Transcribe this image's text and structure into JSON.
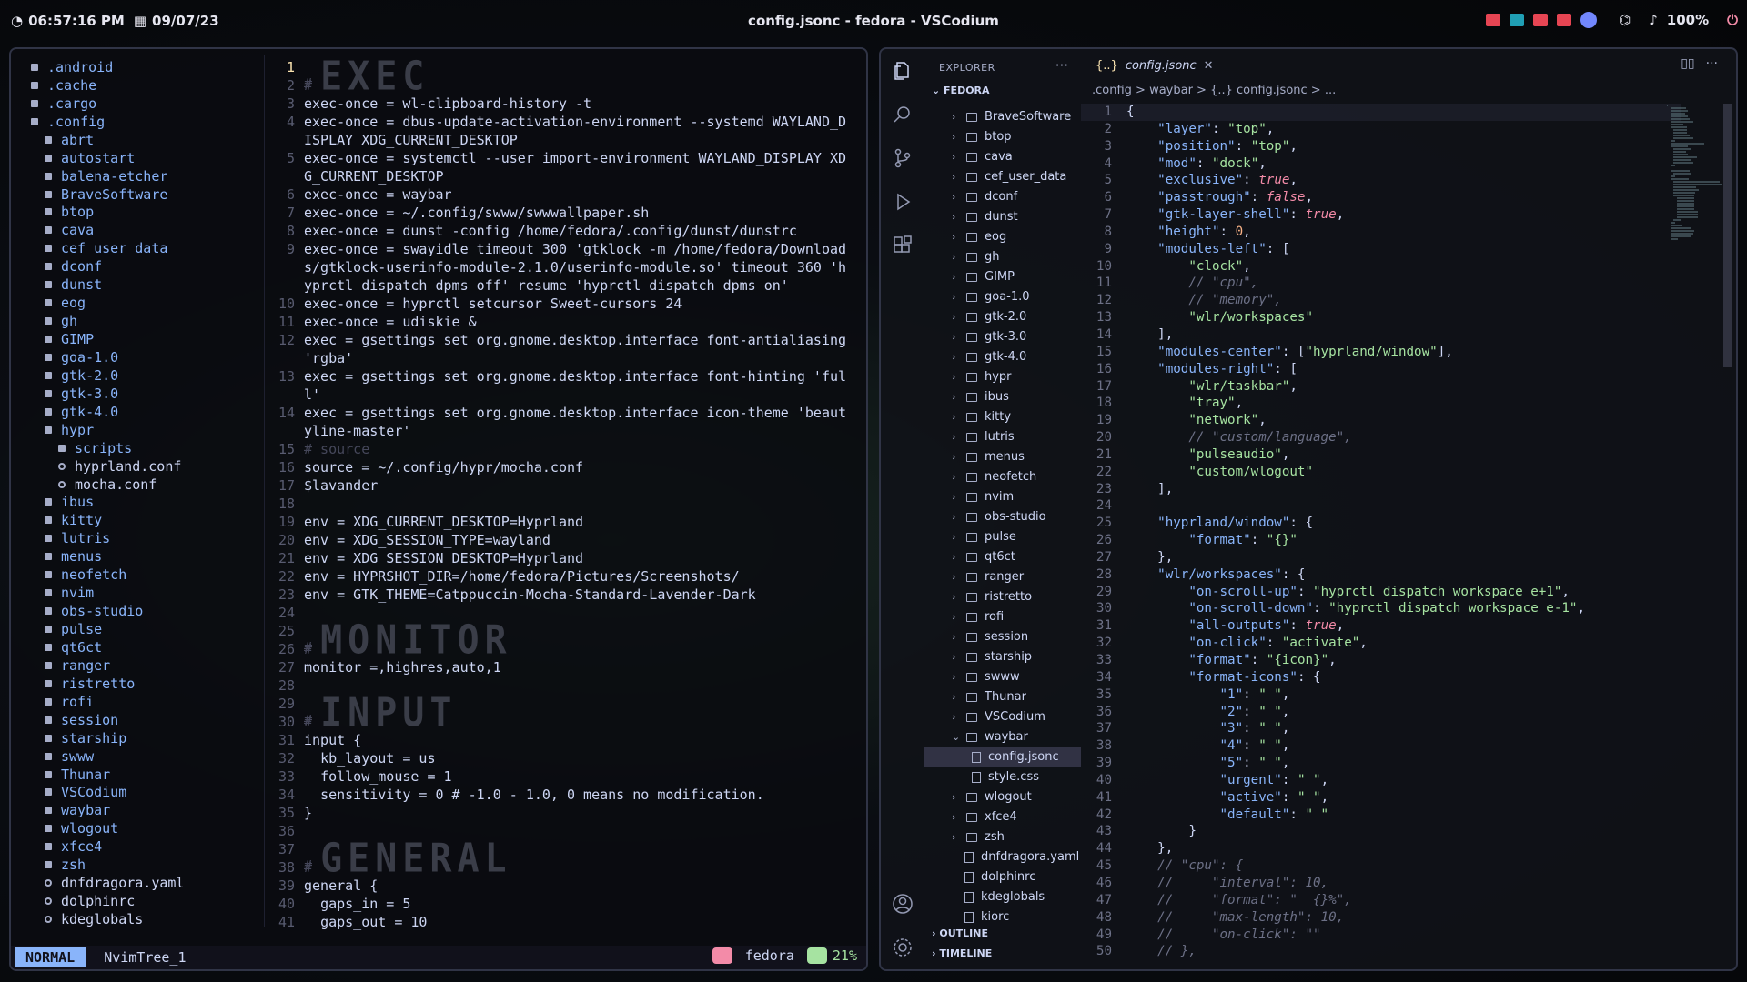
{
  "topbar": {
    "time": "06:57:16 PM",
    "date": "09/07/23",
    "window_title": "config.jsonc - fedora - VSCodium",
    "volume": "100%"
  },
  "nvim": {
    "tree": [
      {
        "name": ".android",
        "type": "dir",
        "indent": 1
      },
      {
        "name": ".cache",
        "type": "dir",
        "indent": 1
      },
      {
        "name": ".cargo",
        "type": "dir",
        "indent": 1
      },
      {
        "name": ".config",
        "type": "dir-open",
        "indent": 1
      },
      {
        "name": "abrt",
        "type": "dir",
        "indent": 2
      },
      {
        "name": "autostart",
        "type": "dir",
        "indent": 2
      },
      {
        "name": "balena-etcher",
        "type": "dir",
        "indent": 2
      },
      {
        "name": "BraveSoftware",
        "type": "dir",
        "indent": 2
      },
      {
        "name": "btop",
        "type": "dir",
        "indent": 2
      },
      {
        "name": "cava",
        "type": "dir",
        "indent": 2
      },
      {
        "name": "cef_user_data",
        "type": "dir",
        "indent": 2
      },
      {
        "name": "dconf",
        "type": "dir",
        "indent": 2
      },
      {
        "name": "dunst",
        "type": "dir",
        "indent": 2
      },
      {
        "name": "eog",
        "type": "dir",
        "indent": 2
      },
      {
        "name": "gh",
        "type": "dir",
        "indent": 2
      },
      {
        "name": "GIMP",
        "type": "dir",
        "indent": 2
      },
      {
        "name": "goa-1.0",
        "type": "dir",
        "indent": 2
      },
      {
        "name": "gtk-2.0",
        "type": "dir",
        "indent": 2
      },
      {
        "name": "gtk-3.0",
        "type": "dir",
        "indent": 2
      },
      {
        "name": "gtk-4.0",
        "type": "dir",
        "indent": 2
      },
      {
        "name": "hypr",
        "type": "dir-open",
        "indent": 2
      },
      {
        "name": "scripts",
        "type": "dir",
        "indent": 3
      },
      {
        "name": "hyprland.conf",
        "type": "file",
        "indent": 3
      },
      {
        "name": "mocha.conf",
        "type": "file",
        "indent": 3
      },
      {
        "name": "ibus",
        "type": "dir",
        "indent": 2
      },
      {
        "name": "kitty",
        "type": "dir",
        "indent": 2
      },
      {
        "name": "lutris",
        "type": "dir",
        "indent": 2
      },
      {
        "name": "menus",
        "type": "dir",
        "indent": 2
      },
      {
        "name": "neofetch",
        "type": "dir",
        "indent": 2
      },
      {
        "name": "nvim",
        "type": "dir",
        "indent": 2
      },
      {
        "name": "obs-studio",
        "type": "dir",
        "indent": 2
      },
      {
        "name": "pulse",
        "type": "dir",
        "indent": 2
      },
      {
        "name": "qt6ct",
        "type": "dir",
        "indent": 2
      },
      {
        "name": "ranger",
        "type": "dir",
        "indent": 2
      },
      {
        "name": "ristretto",
        "type": "dir",
        "indent": 2
      },
      {
        "name": "rofi",
        "type": "dir",
        "indent": 2
      },
      {
        "name": "session",
        "type": "dir",
        "indent": 2
      },
      {
        "name": "starship",
        "type": "dir",
        "indent": 2
      },
      {
        "name": "swww",
        "type": "dir",
        "indent": 2
      },
      {
        "name": "Thunar",
        "type": "dir",
        "indent": 2
      },
      {
        "name": "VSCodium",
        "type": "dir",
        "indent": 2
      },
      {
        "name": "waybar",
        "type": "dir",
        "indent": 2
      },
      {
        "name": "wlogout",
        "type": "dir",
        "indent": 2
      },
      {
        "name": "xfce4",
        "type": "dir",
        "indent": 2
      },
      {
        "name": "zsh",
        "type": "dir",
        "indent": 2
      },
      {
        "name": "dnfdragora.yaml",
        "type": "file",
        "indent": 2
      },
      {
        "name": "dolphinrc",
        "type": "file",
        "indent": 2
      },
      {
        "name": "kdeglobals",
        "type": "file",
        "indent": 2
      }
    ],
    "code": [
      {
        "n": "1",
        "t": "# EXEC",
        "k": "banner"
      },
      {
        "n": "2",
        "t": "#",
        "k": "c"
      },
      {
        "n": "3",
        "t": "exec-once = wl-clipboard-history -t",
        "k": ""
      },
      {
        "n": "4",
        "t": "exec-once = dbus-update-activation-environment --systemd WAYLAND_DISPLAY XDG_CURRENT_DESKTOP",
        "k": ""
      },
      {
        "n": "5",
        "t": "exec-once = systemctl --user import-environment WAYLAND_DISPLAY XDG_CURRENT_DESKTOP",
        "k": ""
      },
      {
        "n": "6",
        "t": "exec-once = waybar",
        "k": ""
      },
      {
        "n": "7",
        "t": "exec-once = ~/.config/swww/swwwallpaper.sh",
        "k": ""
      },
      {
        "n": "8",
        "t": "exec-once = dunst -config /home/fedora/.config/dunst/dunstrc",
        "k": ""
      },
      {
        "n": "9",
        "t": "exec-once = swayidle timeout 300 'gtklock -m /home/fedora/Downloads/gtklock-userinfo-module-2.1.0/userinfo-module.so' timeout 360 'hyprctl dispatch dpms off' resume 'hyprctl dispatch dpms on'",
        "k": ""
      },
      {
        "n": "10",
        "t": "exec-once = hyprctl setcursor Sweet-cursors 24",
        "k": ""
      },
      {
        "n": "11",
        "t": "exec-once = udiskie &",
        "k": ""
      },
      {
        "n": "12",
        "t": "exec = gsettings set org.gnome.desktop.interface font-antialiasing 'rgba'",
        "k": ""
      },
      {
        "n": "13",
        "t": "exec = gsettings set org.gnome.desktop.interface font-hinting 'full'",
        "k": ""
      },
      {
        "n": "14",
        "t": "exec = gsettings set org.gnome.desktop.interface icon-theme 'beautyline-master'",
        "k": ""
      },
      {
        "n": "15",
        "t": "# source",
        "k": "c"
      },
      {
        "n": "16",
        "t": "source = ~/.config/hypr/mocha.conf",
        "k": ""
      },
      {
        "n": "17",
        "t": "$lavander",
        "k": ""
      },
      {
        "n": "18",
        "t": "",
        "k": ""
      },
      {
        "n": "19",
        "t": "env = XDG_CURRENT_DESKTOP=Hyprland",
        "k": ""
      },
      {
        "n": "20",
        "t": "env = XDG_SESSION_TYPE=wayland",
        "k": ""
      },
      {
        "n": "21",
        "t": "env = XDG_SESSION_DESKTOP=Hyprland",
        "k": ""
      },
      {
        "n": "22",
        "t": "env = HYPRSHOT_DIR=/home/fedora/Pictures/Screenshots/",
        "k": ""
      },
      {
        "n": "23",
        "t": "env = GTK_THEME=Catppuccin-Mocha-Standard-Lavender-Dark",
        "k": ""
      },
      {
        "n": "24",
        "t": "",
        "k": ""
      },
      {
        "n": "25",
        "t": "# MONITOR",
        "k": "banner"
      },
      {
        "n": "26",
        "t": "#",
        "k": "c"
      },
      {
        "n": "27",
        "t": "monitor =,highres,auto,1",
        "k": ""
      },
      {
        "n": "28",
        "t": "",
        "k": ""
      },
      {
        "n": "29",
        "t": "# INPUT",
        "k": "banner"
      },
      {
        "n": "30",
        "t": "#",
        "k": "c"
      },
      {
        "n": "31",
        "t": "input {",
        "k": ""
      },
      {
        "n": "32",
        "t": "  kb_layout = us",
        "k": ""
      },
      {
        "n": "33",
        "t": "  follow_mouse = 1",
        "k": ""
      },
      {
        "n": "34",
        "t": "  sensitivity = 0 # -1.0 - 1.0, 0 means no modification.",
        "k": ""
      },
      {
        "n": "35",
        "t": "}",
        "k": ""
      },
      {
        "n": "36",
        "t": "",
        "k": ""
      },
      {
        "n": "37",
        "t": "# GENERAL",
        "k": "banner"
      },
      {
        "n": "38",
        "t": "#",
        "k": "c"
      },
      {
        "n": "39",
        "t": "general {",
        "k": ""
      },
      {
        "n": "40",
        "t": "  gaps_in = 5",
        "k": ""
      },
      {
        "n": "41",
        "t": "  gaps_out = 10",
        "k": ""
      }
    ],
    "status": {
      "mode": "NORMAL",
      "buffer": "NvimTree_1",
      "host": "fedora",
      "percent": "21%"
    }
  },
  "vscode": {
    "explorer_title": "EXPLORER",
    "root": "FEDORA",
    "tab_label": "config.jsonc",
    "breadcrumb": ".config  >  waybar  >  {..} config.jsonc  >  ...",
    "tree": [
      {
        "name": "BraveSoftware",
        "type": "dir"
      },
      {
        "name": "btop",
        "type": "dir"
      },
      {
        "name": "cava",
        "type": "dir"
      },
      {
        "name": "cef_user_data",
        "type": "dir"
      },
      {
        "name": "dconf",
        "type": "dir"
      },
      {
        "name": "dunst",
        "type": "dir"
      },
      {
        "name": "eog",
        "type": "dir"
      },
      {
        "name": "gh",
        "type": "dir"
      },
      {
        "name": "GIMP",
        "type": "dir"
      },
      {
        "name": "goa-1.0",
        "type": "dir"
      },
      {
        "name": "gtk-2.0",
        "type": "dir"
      },
      {
        "name": "gtk-3.0",
        "type": "dir"
      },
      {
        "name": "gtk-4.0",
        "type": "dir"
      },
      {
        "name": "hypr",
        "type": "dir"
      },
      {
        "name": "ibus",
        "type": "dir"
      },
      {
        "name": "kitty",
        "type": "dir"
      },
      {
        "name": "lutris",
        "type": "dir"
      },
      {
        "name": "menus",
        "type": "dir"
      },
      {
        "name": "neofetch",
        "type": "dir"
      },
      {
        "name": "nvim",
        "type": "dir"
      },
      {
        "name": "obs-studio",
        "type": "dir"
      },
      {
        "name": "pulse",
        "type": "dir"
      },
      {
        "name": "qt6ct",
        "type": "dir"
      },
      {
        "name": "ranger",
        "type": "dir"
      },
      {
        "name": "ristretto",
        "type": "dir"
      },
      {
        "name": "rofi",
        "type": "dir"
      },
      {
        "name": "session",
        "type": "dir"
      },
      {
        "name": "starship",
        "type": "dir"
      },
      {
        "name": "swww",
        "type": "dir"
      },
      {
        "name": "Thunar",
        "type": "dir"
      },
      {
        "name": "VSCodium",
        "type": "dir"
      },
      {
        "name": "waybar",
        "type": "dir-open"
      },
      {
        "name": "config.jsonc",
        "type": "child-selected"
      },
      {
        "name": "style.css",
        "type": "child"
      },
      {
        "name": "wlogout",
        "type": "dir"
      },
      {
        "name": "xfce4",
        "type": "dir"
      },
      {
        "name": "zsh",
        "type": "dir"
      },
      {
        "name": "dnfdragora.yaml",
        "type": "file"
      },
      {
        "name": "dolphinrc",
        "type": "file"
      },
      {
        "name": "kdeglobals",
        "type": "file"
      },
      {
        "name": "kiorc",
        "type": "file"
      }
    ],
    "outline_label": "OUTLINE",
    "timeline_label": "TIMELINE",
    "json_lines": [
      "{",
      "    \"layer\": \"top\",",
      "    \"position\": \"top\",",
      "    \"mod\": \"dock\",",
      "    \"exclusive\": true,",
      "    \"passtrough\": false,",
      "    \"gtk-layer-shell\": true,",
      "    \"height\": 0,",
      "    \"modules-left\": [",
      "        \"clock\",",
      "        // \"cpu\",",
      "        // \"memory\",",
      "        \"wlr/workspaces\"",
      "    ],",
      "    \"modules-center\": [\"hyprland/window\"],",
      "    \"modules-right\": [",
      "        \"wlr/taskbar\",",
      "        \"tray\",",
      "        \"network\",",
      "        // \"custom/language\",",
      "        \"pulseaudio\",",
      "        \"custom/wlogout\"",
      "    ],",
      "",
      "    \"hyprland/window\": {",
      "        \"format\": \"{}\"",
      "    },",
      "    \"wlr/workspaces\": {",
      "        \"on-scroll-up\": \"hyprctl dispatch workspace e+1\",",
      "        \"on-scroll-down\": \"hyprctl dispatch workspace e-1\",",
      "        \"all-outputs\": true,",
      "        \"on-click\": \"activate\",",
      "        \"format\": \"{icon}\",",
      "        \"format-icons\": {",
      "            \"1\": \" \",",
      "            \"2\": \" \",",
      "            \"3\": \" \",",
      "            \"4\": \" \",",
      "            \"5\": \" \",",
      "            \"urgent\": \" \",",
      "            \"active\": \" \",",
      "            \"default\": \" \"",
      "        }",
      "    },",
      "    // \"cpu\": {",
      "    //     \"interval\": 10,",
      "    //     \"format\": \"  {}%\",",
      "    //     \"max-length\": 10,",
      "    //     \"on-click\": \"\"",
      "    // },"
    ]
  },
  "colors": {
    "accent": "#89b4fa",
    "string": "#a6e3a1",
    "boolean": "#f38ba8"
  }
}
